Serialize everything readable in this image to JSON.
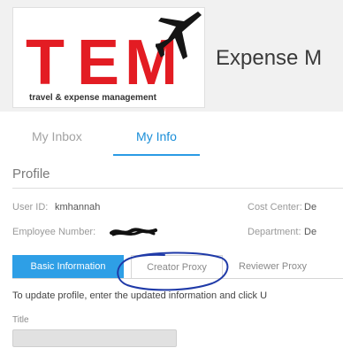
{
  "app": {
    "title": "Expense M"
  },
  "logo": {
    "letters": [
      "T",
      "E",
      "M"
    ],
    "tagline": "travel & expense management",
    "brand_color": "#e31c23"
  },
  "nav": {
    "tabs": [
      {
        "label": "My Inbox",
        "active": false
      },
      {
        "label": "My Info",
        "active": true
      }
    ]
  },
  "profile": {
    "title": "Profile",
    "fields": {
      "user_id": {
        "label": "User ID:",
        "value": "kmhannah"
      },
      "employee_number": {
        "label": "Employee Number:",
        "value": ""
      },
      "cost_center": {
        "label": "Cost Center:",
        "value": "De"
      },
      "department": {
        "label": "Department:",
        "value": "De"
      }
    },
    "subtabs": [
      {
        "label": "Basic Information",
        "active": true
      },
      {
        "label": "Creator Proxy",
        "active": false
      },
      {
        "label": "Reviewer Proxy",
        "active": false
      }
    ],
    "instruction": "To update profile, enter the updated information and click U",
    "title_field": {
      "label": "Title",
      "value": ""
    }
  },
  "colors": {
    "accent": "#2e9fe6",
    "tab_active": "#1a8ed8",
    "annotation": "#1f3aa8"
  }
}
